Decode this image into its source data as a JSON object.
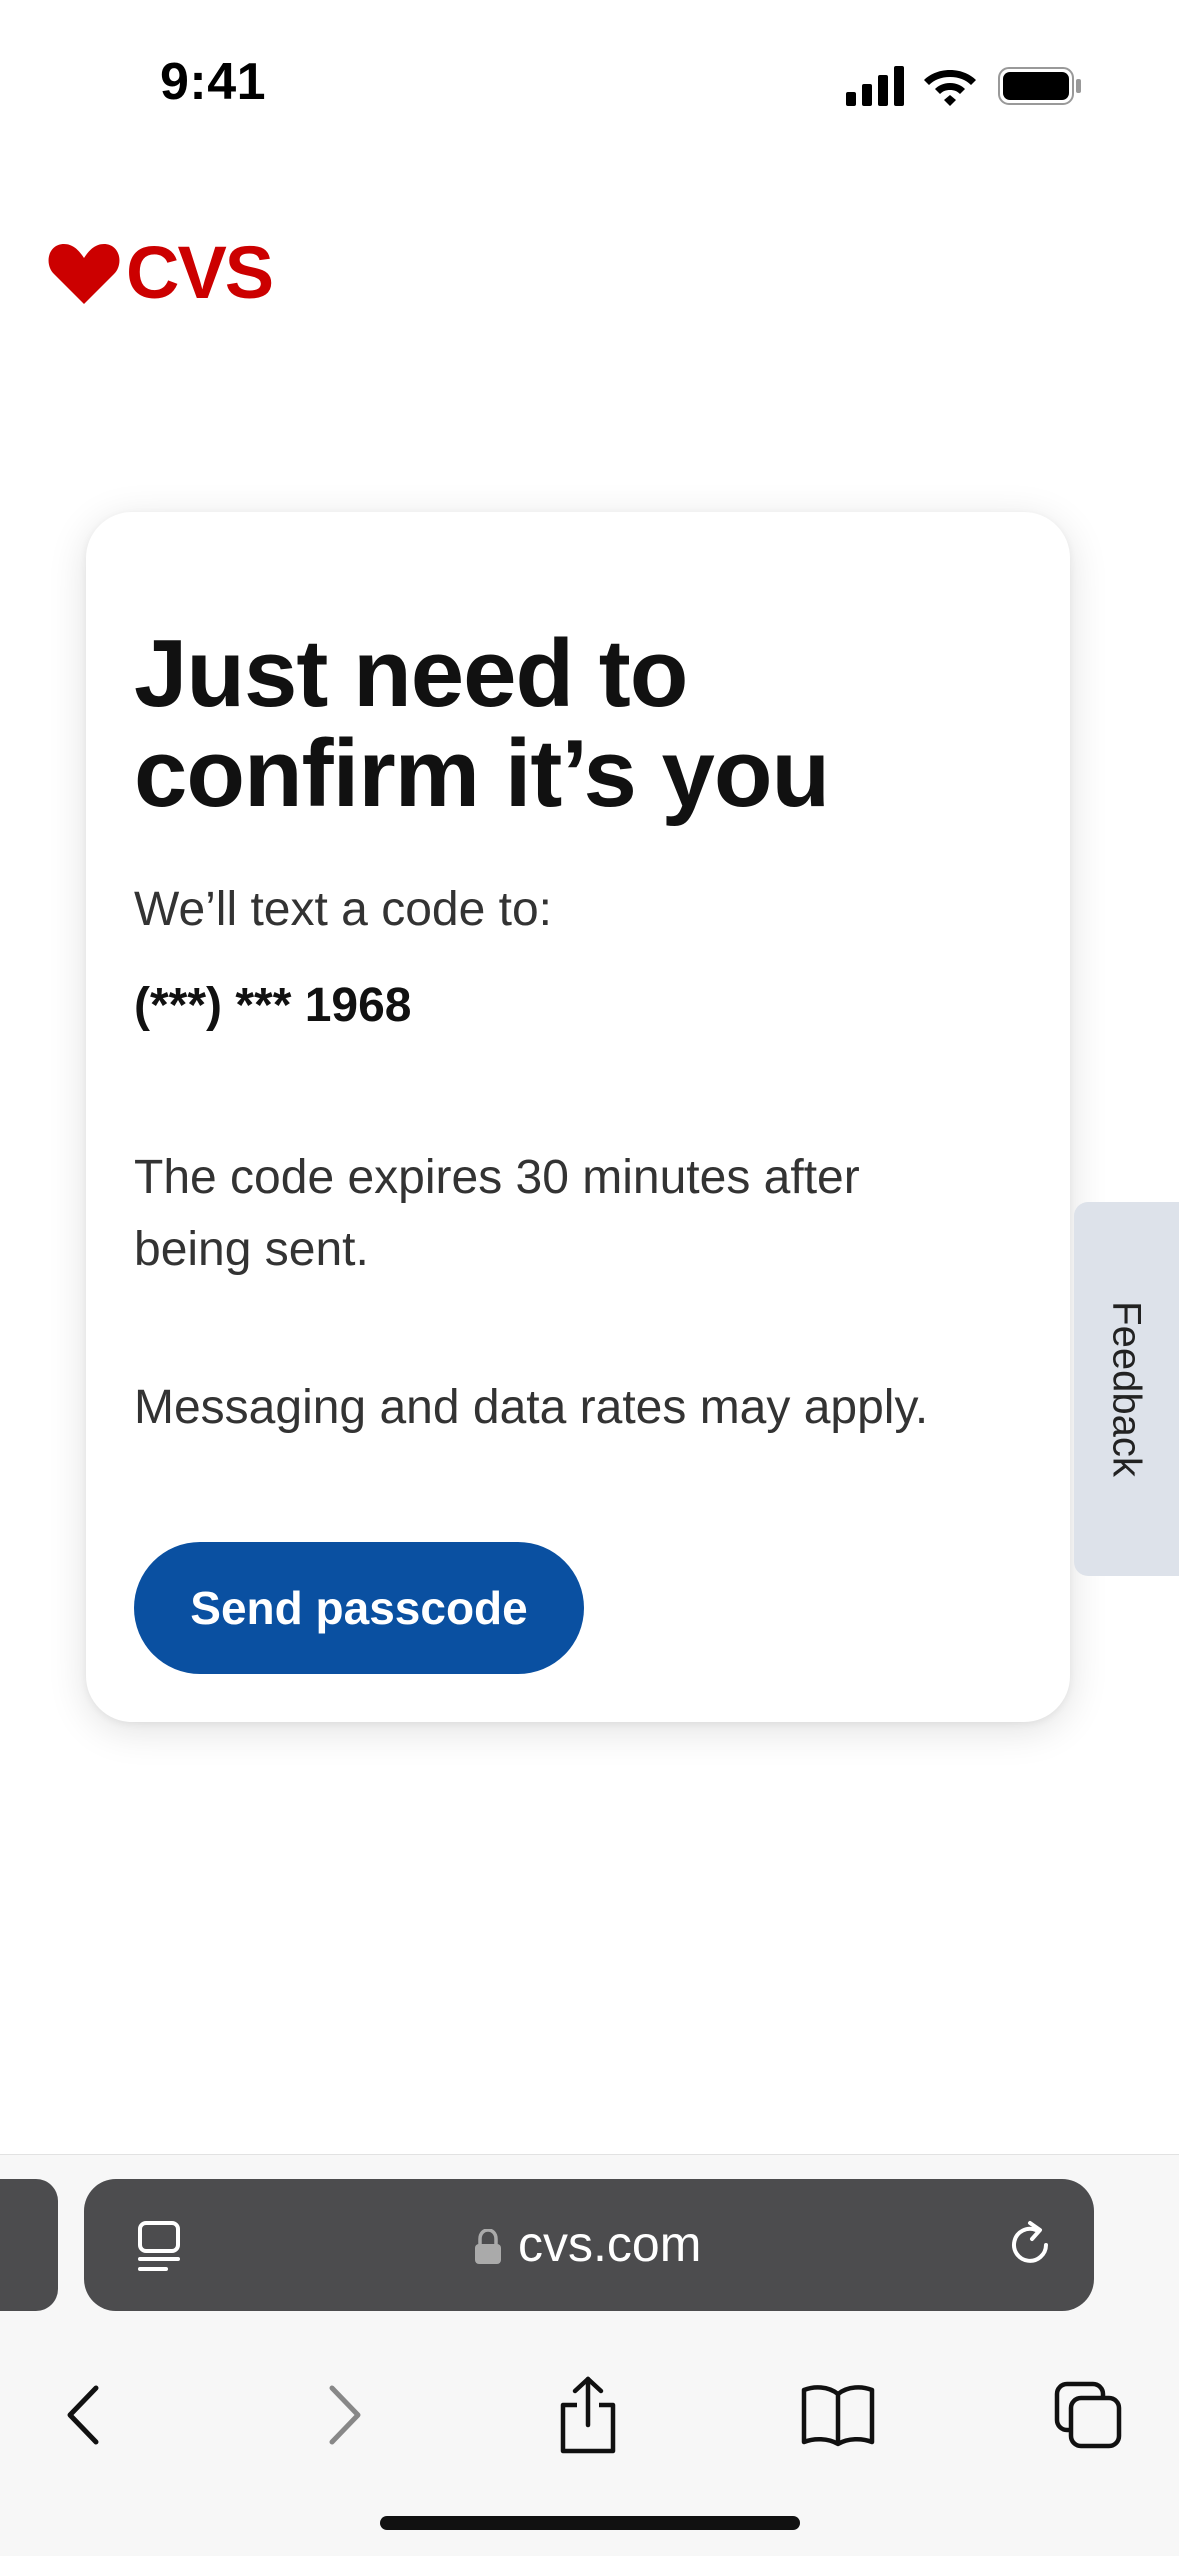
{
  "status_bar": {
    "time": "9:41",
    "icons": [
      "signal-icon",
      "wifi-icon",
      "battery-icon"
    ]
  },
  "brand": {
    "logo_text": "CVS",
    "logo_icon": "heart-icon",
    "color": "#cc0000"
  },
  "card": {
    "title_line1": "Just need to",
    "title_line2": "confirm it’s you",
    "subtitle": "We’ll text a code to:",
    "phone": "(***) *** 1968",
    "expiry": "The code expires 30 minutes after being sent.",
    "rates": "Messaging and data rates may apply.",
    "send_button": "Send passcode"
  },
  "feedback": {
    "label": "Feedback"
  },
  "browser": {
    "url": "cvs.com",
    "icons": [
      "reader-icon",
      "lock-icon",
      "reload-icon",
      "back-icon",
      "forward-icon",
      "share-icon",
      "bookmarks-icon",
      "tabs-icon"
    ]
  },
  "colors": {
    "button": "#0a50a1",
    "address_bar": "#4c4c4e",
    "feedback_tab": "#dde2ea"
  }
}
